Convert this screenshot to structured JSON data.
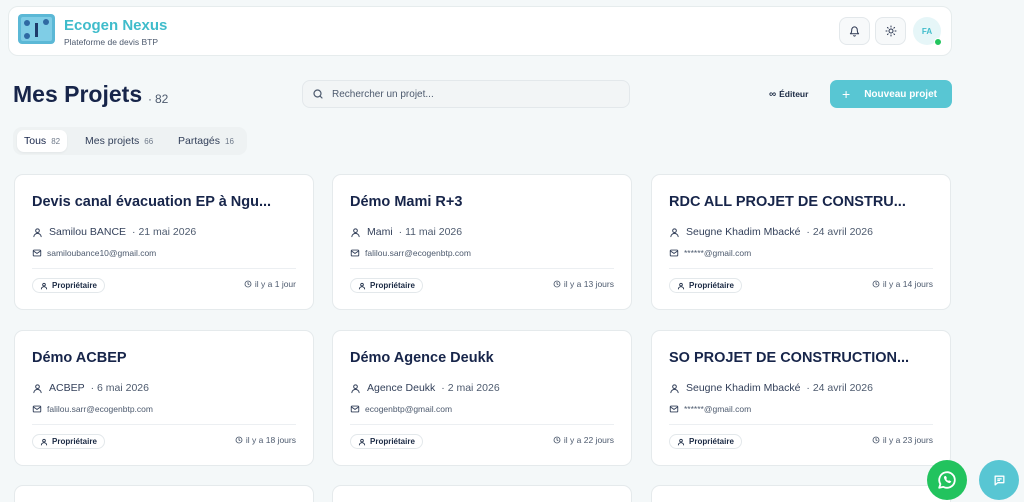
{
  "brand": {
    "title": "Ecogen Nexus",
    "subtitle": "Plateforme de devis BTP"
  },
  "header": {
    "avatar_initials": "FA"
  },
  "page": {
    "title": "Mes Projets",
    "count_sep": "·",
    "count": "82"
  },
  "search": {
    "placeholder": "Rechercher un projet..."
  },
  "toolbar": {
    "editor_label": "Éditeur",
    "new_project_label": "Nouveau projet"
  },
  "tabs": [
    {
      "label": "Tous",
      "count": "82",
      "active": true
    },
    {
      "label": "Mes projets",
      "count": "66"
    },
    {
      "label": "Partagés",
      "count": "16"
    }
  ],
  "projects": [
    {
      "title": "Devis canal évacuation EP à Ngu...",
      "owner": "Samilou BANCE",
      "date": "21 mai 2026",
      "email": "samiloubance10@gmail.com",
      "role": "Propriétaire",
      "updated": "il y a 1 jour"
    },
    {
      "title": "Démo Mami R+3",
      "owner": "Mami",
      "date": "11 mai 2026",
      "email": "falilou.sarr@ecogenbtp.com",
      "role": "Propriétaire",
      "updated": "il y a 13 jours"
    },
    {
      "title": "RDC ALL PROJET DE CONSTRU...",
      "owner": "Seugne Khadim Mbacké",
      "date": "24 avril 2026",
      "email": "******@gmail.com",
      "role": "Propriétaire",
      "updated": "il y a 14 jours"
    },
    {
      "title": "Démo ACBEP",
      "owner": "ACBEP",
      "date": "6 mai 2026",
      "email": "falilou.sarr@ecogenbtp.com",
      "role": "Propriétaire",
      "updated": "il y a 18 jours"
    },
    {
      "title": "Démo Agence Deukk",
      "owner": "Agence Deukk",
      "date": "2 mai 2026",
      "email": "ecogenbtp@gmail.com",
      "role": "Propriétaire",
      "updated": "il y a 22 jours"
    },
    {
      "title": "SO PROJET DE CONSTRUCTION...",
      "owner": "Seugne Khadim Mbacké",
      "date": "24 avril 2026",
      "email": "******@gmail.com",
      "role": "Propriétaire",
      "updated": "il y a 23 jours"
    }
  ],
  "colors": {
    "accent": "#3fbccb",
    "primary_button": "#58c6d3",
    "whatsapp": "#22c35e",
    "title": "#17254a"
  },
  "icons": [
    "bell-icon",
    "sun-icon",
    "search-icon",
    "infinity-icon",
    "plus-icon",
    "user-icon",
    "mail-icon",
    "clock-icon",
    "whatsapp-icon",
    "chat-icon"
  ]
}
